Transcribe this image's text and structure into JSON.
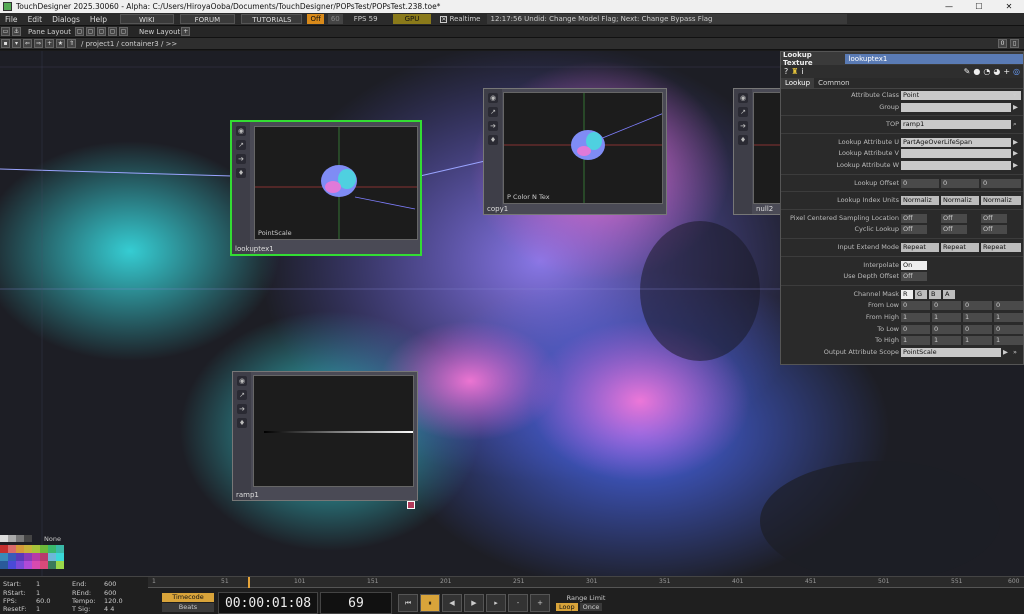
{
  "titlebar": {
    "title": "TouchDesigner 2025.30060 - Alpha: C:/Users/HiroyaOoba/Documents/TouchDesigner/POPsTest/POPsTest.238.toe*",
    "min": "—",
    "max": "☐",
    "close": "✕"
  },
  "menubar": {
    "items": [
      "File",
      "Edit",
      "Dialogs",
      "Help"
    ],
    "wiki": "WIKI",
    "forum": "FORUM",
    "tutorials": "TUTORIALS",
    "off": "Off",
    "num60": "60",
    "fps": "FPS 59",
    "gpu": "GPU",
    "realtime": "Realtime",
    "status": "12:17:56 Undid: Change Model Flag; Next: Change Bypass Flag"
  },
  "panebar": {
    "pane_layout": "Pane Layout",
    "new_layout": "New Layout"
  },
  "pathbar": {
    "path": "/ project1 / container3 / >>",
    "page": "0"
  },
  "nodes": {
    "lookuptex": {
      "name": "lookuptex1",
      "view_label": "PointScale"
    },
    "copy": {
      "name": "copy1",
      "view_label": "P Color N Tex"
    },
    "null": {
      "name": "null2"
    },
    "ramp": {
      "name": "ramp1"
    }
  },
  "params": {
    "header_type": "Lookup Texture",
    "header_name": "lookuptex1",
    "tabs": [
      "Lookup",
      "Common"
    ],
    "attribute_class_label": "Attribute Class",
    "attribute_class": "Point",
    "group_label": "Group",
    "top_label": "TOP",
    "top": "ramp1",
    "lookup_u_label": "Lookup Attribute U",
    "lookup_u": "PartAgeOverLifeSpan",
    "lookup_v_label": "Lookup Attribute V",
    "lookup_w_label": "Lookup Attribute W",
    "offset_label": "Lookup Offset",
    "offset": [
      "0",
      "0",
      "0"
    ],
    "index_units_label": "Lookup Index Units",
    "index_units": [
      "Normaliz",
      "Normaliz",
      "Normaliz"
    ],
    "pixel_centered_label": "Pixel Centered Sampling Location",
    "pixel_centered": [
      "Off",
      "Off",
      "Off"
    ],
    "cyclic_label": "Cyclic Lookup",
    "cyclic": [
      "Off",
      "Off",
      "Off"
    ],
    "extend_label": "Input Extend Mode",
    "extend": [
      "Repeat",
      "Repeat",
      "Repeat"
    ],
    "interpolate_label": "Interpolate",
    "interpolate": "On",
    "depth_label": "Use Depth Offset",
    "depth": "Off",
    "channel_mask_label": "Channel Mask",
    "channel_mask": [
      "R",
      "G",
      "B",
      "A"
    ],
    "from_low_label": "From Low",
    "from_low": [
      "0",
      "0",
      "0",
      "0"
    ],
    "from_high_label": "From High",
    "from_high": [
      "1",
      "1",
      "1",
      "1"
    ],
    "to_low_label": "To Low",
    "to_low": [
      "0",
      "0",
      "0",
      "0"
    ],
    "to_high_label": "To High",
    "to_high": [
      "1",
      "1",
      "1",
      "1"
    ],
    "scope_label": "Output Attribute Scope",
    "scope": "PointScale"
  },
  "palette": {
    "none": "None"
  },
  "stats": {
    "start_l": "Start:",
    "start": "1",
    "end_l": "End:",
    "end": "600",
    "rstart_l": "RStart:",
    "rstart": "1",
    "rend_l": "REnd:",
    "rend": "600",
    "fps_l": "FPS:",
    "fps": "60.0",
    "tempo_l": "Tempo:",
    "tempo": "120.0",
    "resetf_l": "ResetF:",
    "resetf": "1",
    "tsig_l": "T Sig:",
    "tsig": "4   4"
  },
  "ruler": [
    "1",
    "51",
    "101",
    "151",
    "201",
    "251",
    "301",
    "351",
    "401",
    "451",
    "501",
    "551",
    "600"
  ],
  "transport": {
    "timecode": "Timecode",
    "beats": "Beats",
    "time": "00:00:01:08",
    "frame": "69",
    "range_limit": "Range Limit",
    "loop": "Loop",
    "once": "Once"
  }
}
